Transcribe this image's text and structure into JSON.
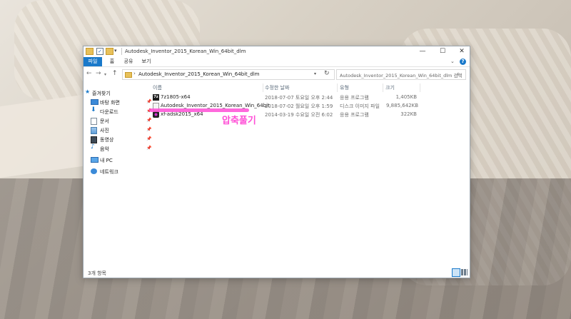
{
  "window": {
    "title": "Autodesk_Inventor_2015_Korean_Win_64bit_dlm",
    "controls": {
      "minimize": "—",
      "maximize": "☐",
      "close": "✕"
    }
  },
  "ribbon": {
    "tabs": [
      "파일",
      "홈",
      "공유",
      "보기"
    ],
    "help": "?"
  },
  "address": {
    "path": "Autodesk_Inventor_2015_Korean_Win_64bit_dlm",
    "separator": "›"
  },
  "search": {
    "placeholder": "Autodesk_Inventor_2015_Korean_Win_64bit_dlm 검색"
  },
  "nav": {
    "quick_access": "즐겨찾기",
    "items": [
      {
        "label": "바탕 화면",
        "icon": "desktop-icon"
      },
      {
        "label": "다운로드",
        "icon": "download-icon"
      },
      {
        "label": "문서",
        "icon": "document-icon"
      },
      {
        "label": "사진",
        "icon": "pictures-icon"
      },
      {
        "label": "동영상",
        "icon": "video-icon"
      },
      {
        "label": "음악",
        "icon": "music-icon"
      }
    ],
    "this_pc": "내 PC",
    "network": "네트워크",
    "pin": "📌"
  },
  "columns": [
    "이름",
    "수정한 날짜",
    "유형",
    "크기"
  ],
  "files": [
    {
      "name": "7z1805-x64",
      "date": "2018-07-07 토요일 오후 2:44",
      "type": "응용 프로그램",
      "size": "1,405KB",
      "icon": "7zip-icon"
    },
    {
      "name": "Autodesk_Inventor_2015_Korean_Win_64bit",
      "date": "2018-07-02 월요일 오후 1:59",
      "type": "디스크 이미지 파일",
      "size": "9,885,642KB",
      "icon": "disk-image-icon"
    },
    {
      "name": "xf-adsk2015_x64",
      "date": "2014-03-19 수요일 오전 6:02",
      "type": "응용 프로그램",
      "size": "322KB",
      "icon": "keygen-app-icon"
    }
  ],
  "annotation": {
    "text": "압축풀기",
    "color": "#ff4fd6"
  },
  "status": {
    "item_count": "3개 항목"
  },
  "colors": {
    "accent": "#1979ca",
    "highlight": "#ff4fd6"
  }
}
